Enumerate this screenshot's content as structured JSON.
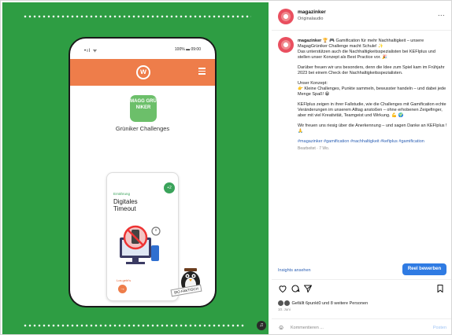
{
  "post": {
    "username": "magazinker",
    "subtitle": "Originalaudio",
    "more_label": "...",
    "caption": {
      "intro_user": "magazinker",
      "intro": "🏆 🎮 Gamification für mehr Nachhaltigkeit – unsere MagagGrüniker Challenge macht Schule! ✨",
      "line2": "Das unterstützen auch die Nachhaltigkeitsspezialisten bei KEFIplus und stellen unser Konzept als Best Practice vor. 🎉",
      "para2": "Darüber freuen wir uns besonders, denn die Idee zum Spiel kam im Frühjahr 2023 bei einem Check der Nachhaltigkeitsspezialisten.",
      "concept_title": "Unser Konzept:",
      "concept": "👉 Kleine Challenges, Punkte sammeln, bewusster handeln – und dabei jede Menge Spaß! 😁",
      "para4": "KEFIplus zeigen in ihrer Fallstudie, wie die Challenges mit Gamification echte Veränderungen im unserem Alltag anstoßen – ohne erhobenen Zeigefinger, aber mit viel Kreativität, Teamgeist und Wirkung. 💪 🌍",
      "para5": "Wir freuen uns riesig über die Anerkennung – und sagen Danke an KEFIplus ! 🙏",
      "hashtags": "#magazinker #gamification #nachhaltigkeit #kefiplus #gamification",
      "meta": "Bearbeitet · 7 Wo."
    },
    "insights_label": "Insights ansehen",
    "boost_label": "Reel bewerben",
    "likes_text": "Gefällt 6punkt0 und 8 weitere Personen",
    "date": "10. Juni",
    "comment_placeholder": "Kommentieren ...",
    "post_label": "Posten"
  },
  "media": {
    "status_left": "•ıl ᯤ",
    "status_right": "100% ▬ 09:00",
    "brand_text": "MAGG GRÜ NIKER",
    "app_title": "Grüniker Challenges",
    "card": {
      "points": "+2",
      "category": "Ernährung",
      "title_1": "Digitales",
      "title_2": "Timeout",
      "go_label": "Los geht's",
      "go_symbol": "→"
    },
    "sticker": "BIO FAKTISCH",
    "badge": "♫"
  },
  "colors": {
    "green_bg": "#2e9d43",
    "orange_bar": "#ee7d4a",
    "link_blue": "#2b5fb4",
    "button_blue": "#2f7be3"
  }
}
